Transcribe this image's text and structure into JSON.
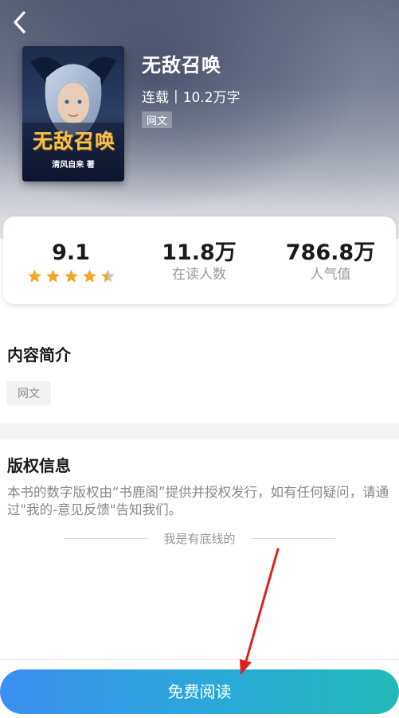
{
  "book": {
    "title": "无敌召唤",
    "status": "连载",
    "separator": "|",
    "word_count": "10.2万字",
    "tag": "网文",
    "cover": {
      "title_text": "无敌召唤",
      "author_text": "清风自来",
      "author_suffix": "著"
    }
  },
  "stats": {
    "rating": "9.1",
    "rating_stars": 4.5,
    "readers_value": "11.8万",
    "readers_label": "在读人数",
    "popularity_value": "786.8万",
    "popularity_label": "人气值"
  },
  "intro": {
    "title": "内容简介",
    "tag": "网文"
  },
  "copyright": {
    "title": "版权信息",
    "text": "本书的数字版权由“书鹿阁”提供并授权发行，如有任何疑问，请通过\"我的-意见反馈\"告知我们。",
    "bottom_note": "我是有底线的"
  },
  "action": {
    "read_button": "免费阅读"
  },
  "colors": {
    "star": "#f5a623",
    "button_gradient_start": "#3a8ff0",
    "button_gradient_end": "#23b9b8",
    "annotation_arrow": "#e02020"
  },
  "icons": {
    "back": "chevron-left-icon",
    "star": "star-icon"
  }
}
